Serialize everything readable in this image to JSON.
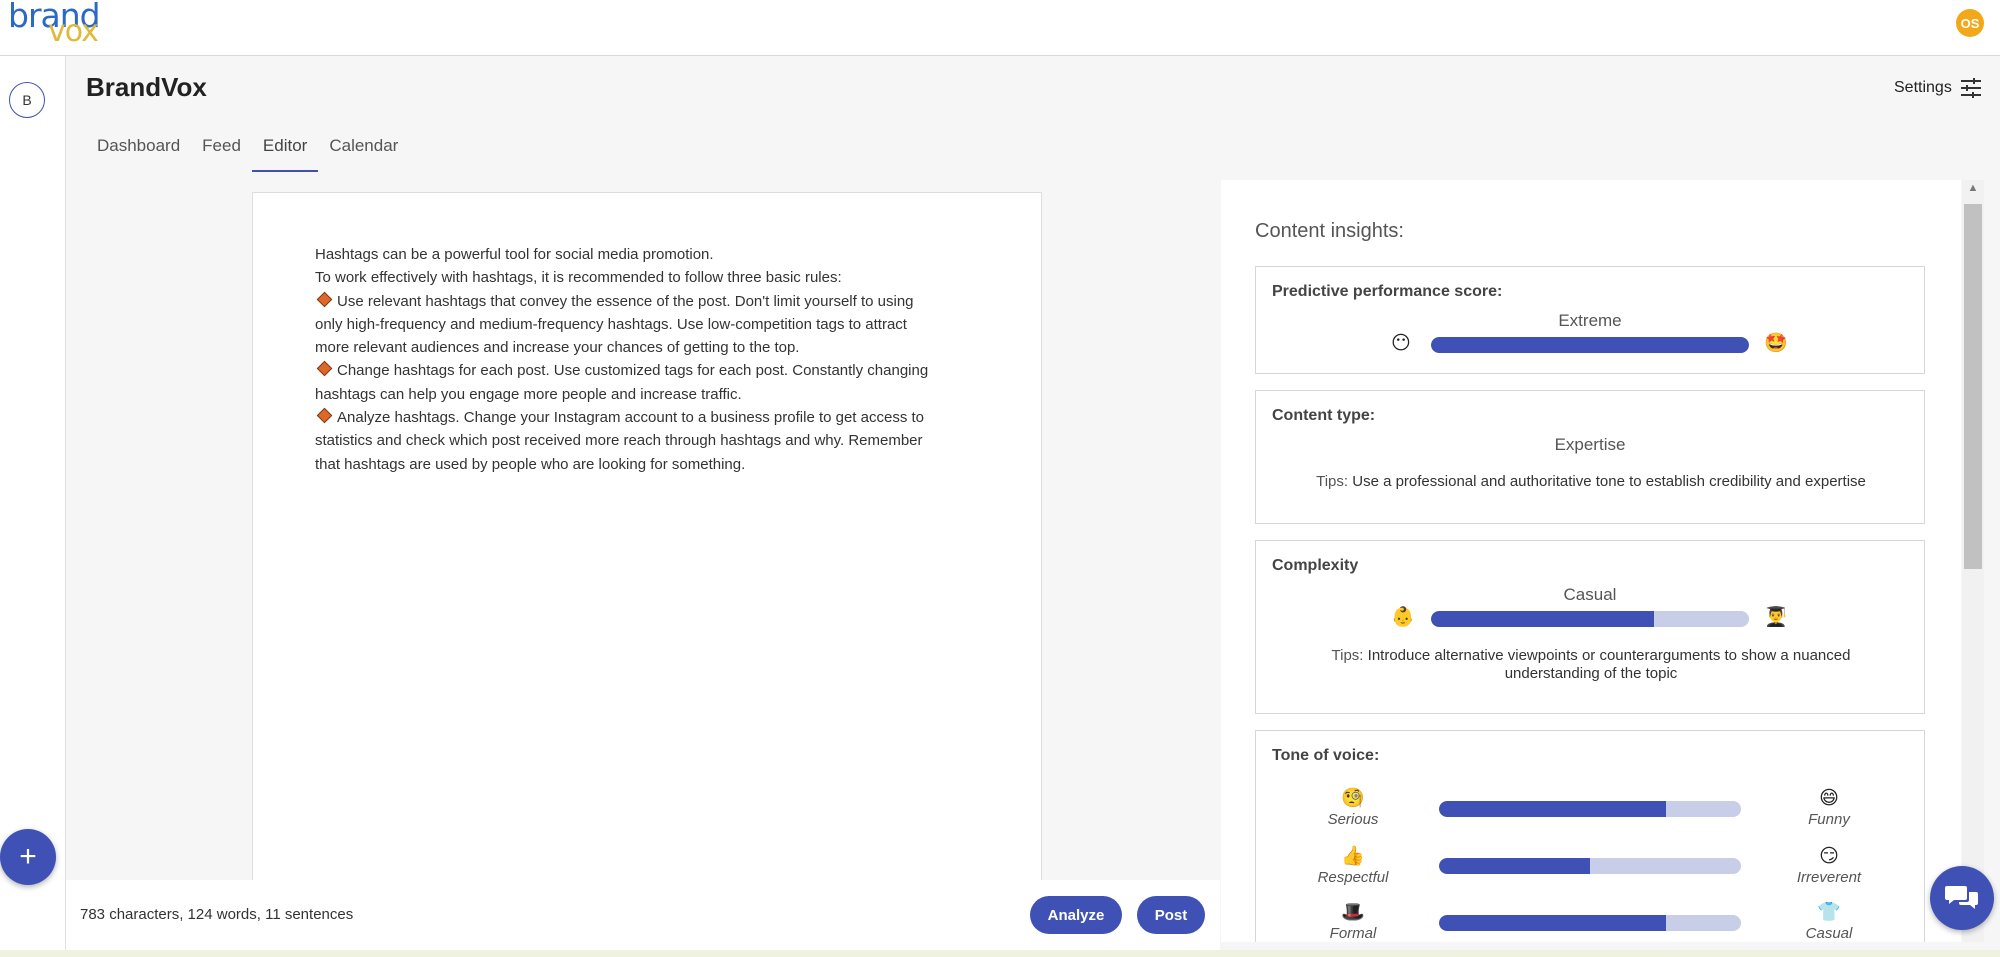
{
  "app": {
    "logo_line1": "brand",
    "logo_line2": "vox",
    "user_initials": "OS",
    "rail_initial": "B",
    "brand_title": "BrandVox",
    "settings_label": "Settings"
  },
  "tabs": [
    {
      "label": "Dashboard",
      "active": false
    },
    {
      "label": "Feed",
      "active": false
    },
    {
      "label": "Editor",
      "active": true
    },
    {
      "label": "Calendar",
      "active": false
    }
  ],
  "editor": {
    "intro1": "Hashtags can be a powerful tool for social media promotion.",
    "intro2": "To work effectively with hashtags, it is recommended to follow three basic rules:",
    "rule1_lines": [
      "Use relevant hashtags that convey the essence of the post. Don't limit yourself to using",
      "only high-frequency and medium-frequency hashtags. Use low-competition tags to attract",
      "more relevant audiences and increase your chances of getting to the top."
    ],
    "rule2_lines": [
      "Change hashtags for each post. Use customized tags for each post. Constantly changing",
      "hashtags can help you engage more people and increase traffic."
    ],
    "rule3_lines": [
      "Analyze hashtags. Change your Instagram account to a business profile to get access to",
      "statistics and check which post received more reach through hashtags and why. Remember",
      "that hashtags are used by people who are looking for something."
    ],
    "stats": "783 characters, 124 words, 11 sentences",
    "analyze_label": "Analyze",
    "post_label": "Post"
  },
  "insights": {
    "title": "Content insights:",
    "performance": {
      "title": "Predictive performance score:",
      "value": "Extreme",
      "level": 1.0,
      "emoji_low": "😶",
      "emoji_high": "🤩"
    },
    "content_type": {
      "title": "Content type:",
      "value": "Expertise",
      "tips_label": "Tips:",
      "tips": "Use a professional and authoritative tone to establish credibility and expertise"
    },
    "complexity": {
      "title": "Complexity",
      "value": "Casual",
      "level": 0.7,
      "emoji_low": "👶",
      "emoji_high": "👨‍🎓",
      "tips_label": "Tips:",
      "tips": "Introduce alternative viewpoints or counterarguments to show a nuanced understanding of the topic"
    },
    "tone": {
      "title": "Tone of voice:",
      "rows": [
        {
          "left_emoji": "🧐",
          "left": "Serious",
          "right_emoji": "😄",
          "right": "Funny",
          "level": 0.75
        },
        {
          "left_emoji": "👍",
          "left": "Respectful",
          "right_emoji": "😏",
          "right": "Irreverent",
          "level": 0.5
        },
        {
          "left_emoji": "🎩",
          "left": "Formal",
          "right_emoji": "👕",
          "right": "Casual",
          "level": 0.75
        }
      ]
    }
  },
  "colors": {
    "accent": "#3f51b5",
    "bar_track": "#c8cde8",
    "avatar": "#f3a81a",
    "diamond": "#e0672a"
  }
}
